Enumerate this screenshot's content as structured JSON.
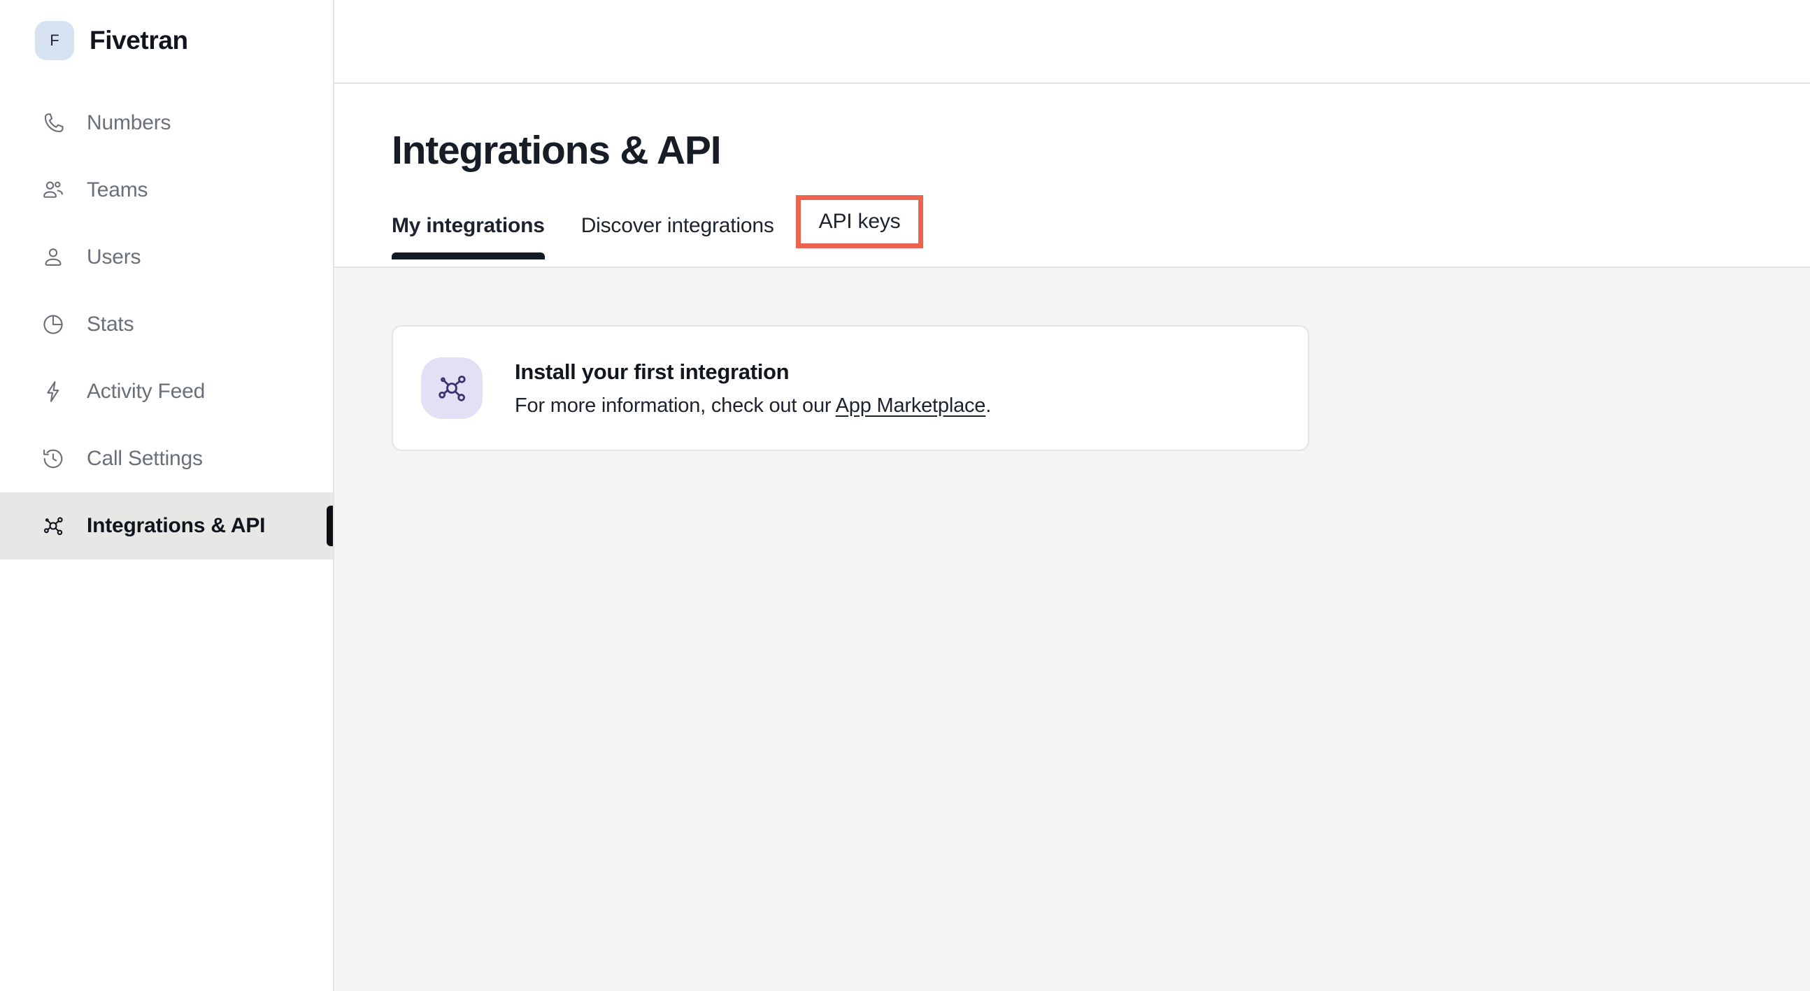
{
  "brand": {
    "initial": "F",
    "name": "Fivetran",
    "logo_bg": "#d7e2f2"
  },
  "sidebar": {
    "items": [
      {
        "label": "Numbers",
        "icon": "phone-icon",
        "active": false
      },
      {
        "label": "Teams",
        "icon": "people-icon",
        "active": false
      },
      {
        "label": "Users",
        "icon": "user-icon",
        "active": false
      },
      {
        "label": "Stats",
        "icon": "pie-chart-icon",
        "active": false
      },
      {
        "label": "Activity Feed",
        "icon": "lightning-bolt-icon",
        "active": false
      },
      {
        "label": "Call Settings",
        "icon": "clock-rewind-icon",
        "active": false
      },
      {
        "label": "Integrations & API",
        "icon": "network-nodes-icon",
        "active": true
      }
    ]
  },
  "main": {
    "page_title": "Integrations & API",
    "tabs": [
      {
        "label": "My integrations",
        "active": true,
        "annotated": false
      },
      {
        "label": "Discover integrations",
        "active": false,
        "annotated": false
      },
      {
        "label": "API keys",
        "active": false,
        "annotated": true
      }
    ],
    "annotation_color": "#ec6350"
  },
  "card": {
    "icon": "network-nodes-icon",
    "icon_bg": "#e3e0f6",
    "title": "Install your first integration",
    "desc_prefix": "For more information, check out our ",
    "link_label": "App Marketplace",
    "desc_suffix": "."
  }
}
